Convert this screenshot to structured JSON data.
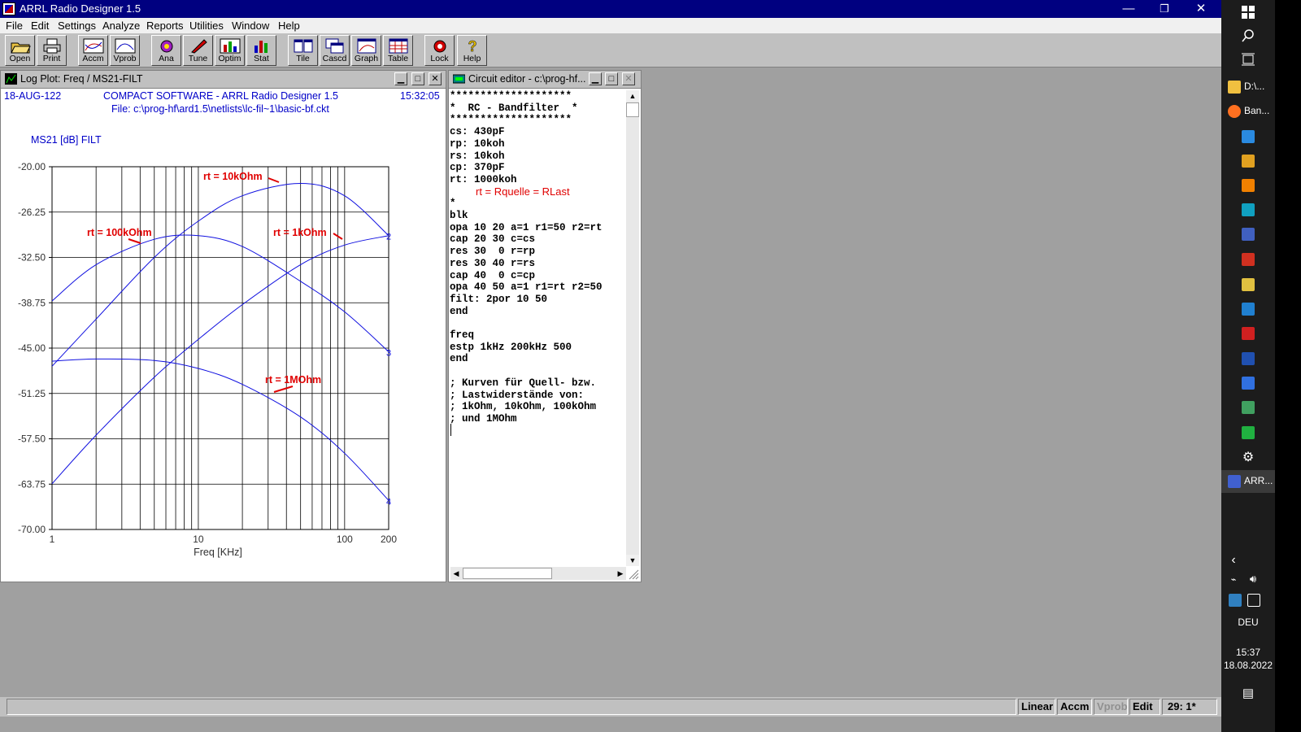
{
  "window": {
    "title": "ARRL Radio Designer 1.5",
    "min": "—",
    "restore": "❐",
    "close": "✕"
  },
  "menu": [
    "File",
    "Edit",
    "Settings",
    "Analyze",
    "Reports",
    "Utilities",
    "Window",
    "Help"
  ],
  "toolbar": [
    "Open",
    "Print",
    "Accm",
    "Vprob",
    "Ana",
    "Tune",
    "Optim",
    "Stat",
    "Tile",
    "Cascd",
    "Graph",
    "Table",
    "Lock",
    "Help"
  ],
  "plot_window": {
    "title": "Log Plot: Freq / MS21-FILT",
    "date": "18-AUG-122",
    "header": "COMPACT SOFTWARE - ARRL Radio Designer 1.5",
    "file": "File: c:\\prog-hf\\ard1.5\\netlists\\lc-fil~1\\basic-bf.ckt",
    "time": "15:32:05",
    "ylabel": "MS21 [dB] FILT",
    "xlabel": "Freq [KHz]"
  },
  "chart_data": {
    "type": "line",
    "title": "MS21 [dB] FILT",
    "xlabel": "Freq [KHz]",
    "ylabel": "MS21 [dB] FILT",
    "xscale": "log",
    "xlim": [
      1,
      200
    ],
    "ylim": [
      -70,
      -20
    ],
    "xticks": [
      "1",
      "10",
      "100",
      "200"
    ],
    "yticks": [
      "-20.00",
      "-26.25",
      "-32.50",
      "-38.75",
      "-45.00",
      "-51.25",
      "-57.50",
      "-63.75",
      "-70.00"
    ],
    "grid": true,
    "series": [
      {
        "name": "rt = 1kOhm",
        "marker": "1",
        "x": [
          1,
          2,
          5,
          10,
          20,
          50,
          100,
          200
        ],
        "y": [
          -63.7,
          -57.0,
          -49.0,
          -43.8,
          -39.0,
          -33.5,
          -30.8,
          -29.5
        ]
      },
      {
        "name": "rt = 10kOhm",
        "marker": "2",
        "x": [
          1,
          2,
          5,
          10,
          20,
          50,
          100,
          200
        ],
        "y": [
          -47.5,
          -41.0,
          -32.5,
          -27.5,
          -24.0,
          -22.3,
          -24.0,
          -29.5
        ]
      },
      {
        "name": "rt = 100kOhm",
        "marker": "3",
        "x": [
          1,
          2,
          5,
          10,
          20,
          50,
          100,
          200
        ],
        "y": [
          -38.5,
          -33.5,
          -30.0,
          -29.5,
          -31.0,
          -35.8,
          -40.0,
          -45.5
        ]
      },
      {
        "name": "rt = 1MOhm",
        "marker": "4",
        "x": [
          1,
          2,
          5,
          10,
          20,
          50,
          100,
          200
        ],
        "y": [
          -46.8,
          -46.5,
          -46.7,
          -47.8,
          -50.0,
          -54.5,
          -59.5,
          -66.0
        ]
      }
    ],
    "annotations": [
      "rt = 10kOhm",
      "rt = 100kOhm",
      "rt = 1kOhm",
      "rt = 1MOhm"
    ],
    "end_markers": [
      "2",
      "3",
      "4"
    ]
  },
  "editor": {
    "title": "Circuit editor - c:\\prog-hf...",
    "lines": [
      "********************",
      "*  RC - Bandfilter  *",
      "********************",
      "cs: 430pF",
      "rp: 10koh",
      "rs: 10koh",
      "cp: 370pF",
      "rt: 1000koh",
      "",
      "*",
      "blk",
      "opa 10 20 a=1 r1=50 r2=rt",
      "cap 20 30 c=cs",
      "res 30  0 r=rp",
      "res 30 40 r=rs",
      "cap 40  0 c=cp",
      "opa 40 50 a=1 r1=rt r2=50",
      "filt: 2por 10 50",
      "end",
      "",
      "freq",
      "estp 1kHz 200kHz 500",
      "end",
      "",
      "; Kurven für Quell- bzw.",
      "; Lastwiderstände von:",
      "; 1kOhm, 10kOhm, 100kOhm",
      "; und 1MOhm"
    ],
    "red_note": "rt = Rquelle = RLast"
  },
  "status": {
    "linear": "Linear",
    "accm": "Accm",
    "vprob": "Vprob",
    "edit": "Edit",
    "pos": "29: 1*"
  },
  "taskbar": {
    "items": [
      "D:\\...",
      "Ban...",
      "ARR..."
    ],
    "lang": "DEU",
    "time": "15:37",
    "date": "18.08.2022"
  }
}
